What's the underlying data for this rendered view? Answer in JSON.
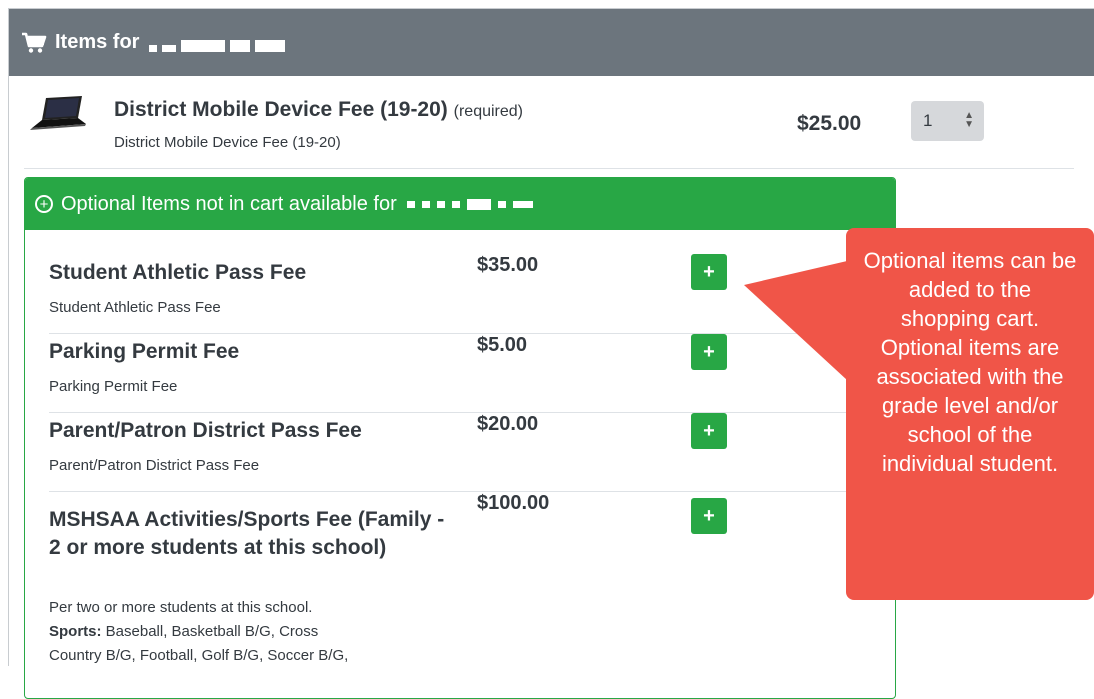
{
  "header": {
    "title": "Items for",
    "icon": "cart-icon"
  },
  "required_item": {
    "name": "District Mobile Device Fee (19-20)",
    "tag": "(required)",
    "description": "District Mobile Device Fee (19-20)",
    "price": "$25.00",
    "quantity": "1"
  },
  "optional": {
    "header": "Optional Items not in cart available for",
    "add_label": "+",
    "items": [
      {
        "name": "Student Athletic Pass Fee",
        "description": "Student Athletic Pass Fee",
        "price": "$35.00"
      },
      {
        "name": "Parking Permit Fee",
        "description": "Parking Permit Fee",
        "price": "$5.00"
      },
      {
        "name": "Parent/Patron District Pass Fee",
        "description": "Parent/Patron District Pass Fee",
        "price": "$20.00"
      },
      {
        "name": "MSHSAA Activities/Sports Fee (Family - 2 or more students at this school)",
        "description": "Per two or more students at this school.",
        "price": "$100.00"
      }
    ],
    "sports_label": "Sports:",
    "sports_text": " Baseball, Basketball B/G, Cross",
    "sports_text_2": "Country B/G, Football, Golf B/G, Soccer B/G,"
  },
  "callout": {
    "text": "Optional items can be added to the shopping cart. Optional items are associated with the grade level and/or school of the individual student."
  },
  "colors": {
    "header_bg": "#6c757d",
    "green": "#28a745",
    "callout": "#f05548"
  }
}
